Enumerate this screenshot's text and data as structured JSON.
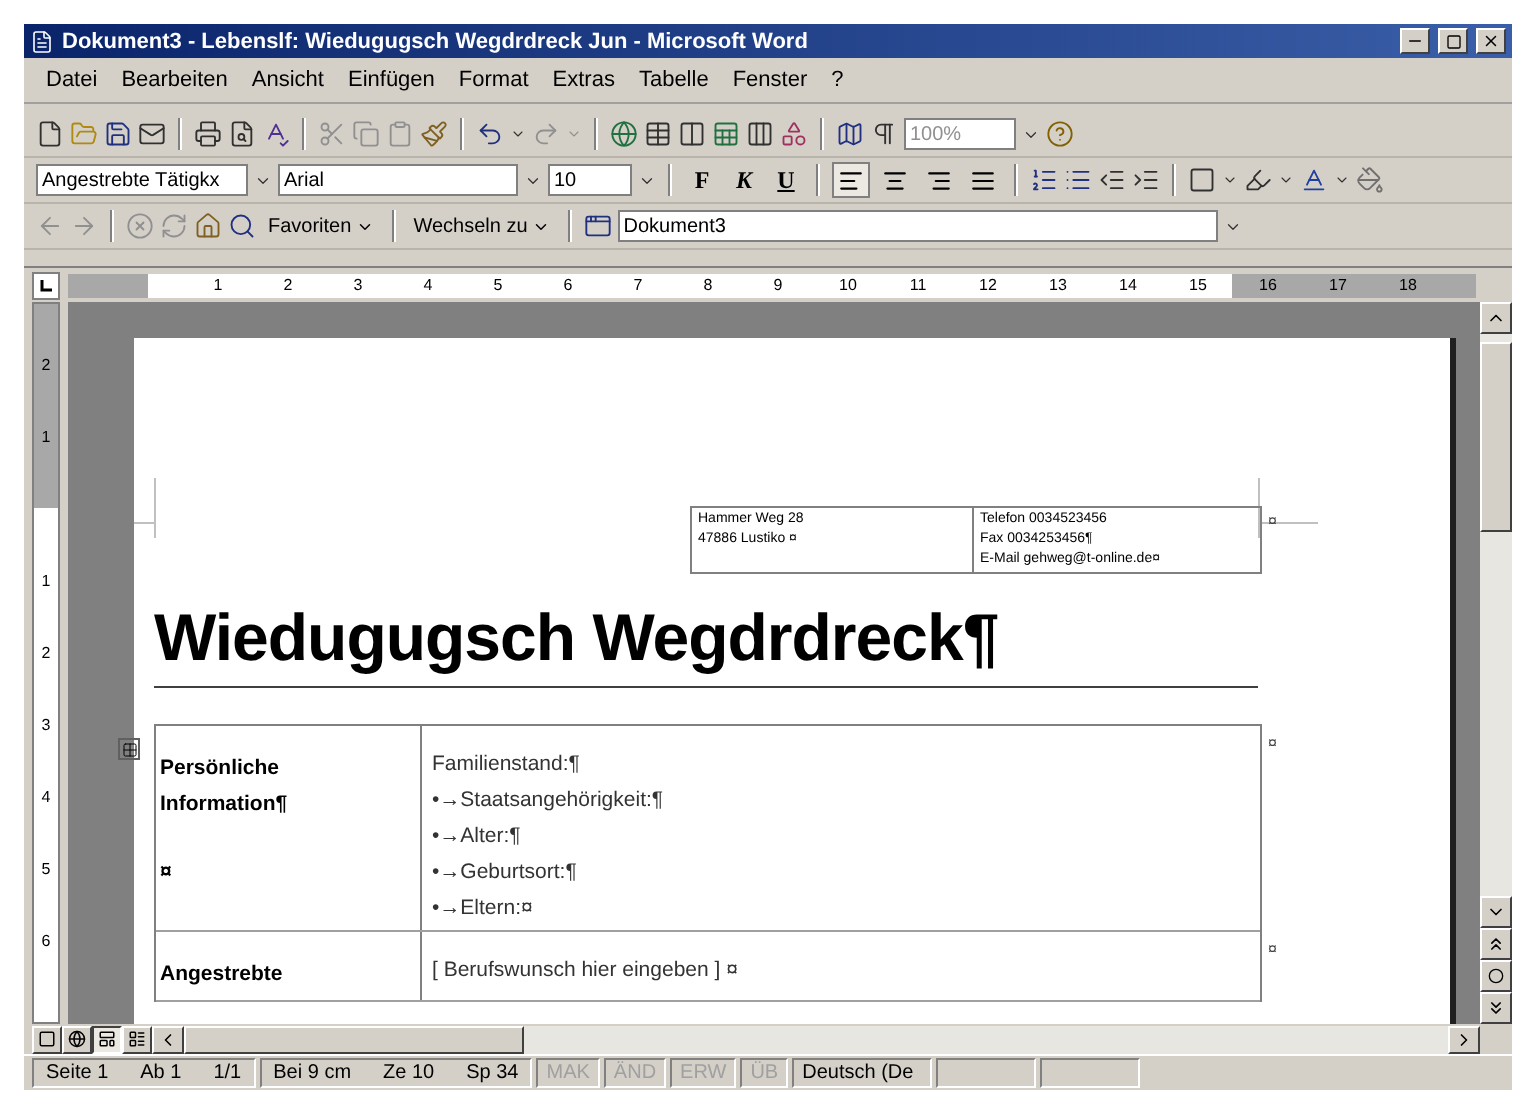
{
  "window": {
    "title": "Dokument3 - Lebenslf: Wiedugugsch Wegdrdreck Jun - Microsoft Word"
  },
  "menu": [
    "Datei",
    "Bearbeiten",
    "Ansicht",
    "Einfügen",
    "Format",
    "Extras",
    "Tabelle",
    "Fenster",
    "?"
  ],
  "standard_toolbar": {
    "zoom": "100%"
  },
  "format_toolbar": {
    "style": "Angestrebte Tätigkx",
    "font": "Arial",
    "size": "10",
    "toggles": [
      {
        "label": "F",
        "selected": false
      },
      {
        "label": "K",
        "selected": false
      },
      {
        "label": "U",
        "selected": false
      }
    ],
    "alignments": [
      {
        "selected": true
      },
      {
        "selected": false
      },
      {
        "selected": false
      },
      {
        "selected": false
      }
    ]
  },
  "web_toolbar": {
    "favorites": "Favoriten",
    "go_to": "Wechseln zu",
    "address": "Dokument3"
  },
  "ruler": {
    "labels": [
      "1",
      "2",
      "3",
      "4",
      "5",
      "6",
      "7",
      "8",
      "9",
      "10",
      "11",
      "12",
      "13",
      "14",
      "15",
      "16",
      "17",
      "18"
    ]
  },
  "vertical_ruler": {
    "top_labels": [
      "2",
      "1"
    ],
    "labels": [
      "1",
      "2",
      "3",
      "4",
      "5",
      "6"
    ]
  },
  "document": {
    "address": {
      "left": [
        "Hammer Weg 28",
        "47886 Lustiko ¤"
      ],
      "right": [
        "Telefon 0034523456",
        "Fax 0034253456¶",
        "E-Mail gehweg@t-online.de¤"
      ],
      "end_mark": "¤"
    },
    "heading": "Wiedugugsch Wegdrdreck¶",
    "sections": [
      {
        "label": "Persönliche Information¶",
        "label_mark": "¤",
        "lines": [
          "Familienstand:¶",
          "•→Staatsangehörigkeit:¶",
          "•→Alter:¶",
          "•→Geburtsort:¶",
          "•→Eltern:¤"
        ],
        "end_mark": "¤"
      },
      {
        "label": "Angestrebte",
        "lines": [
          "[  Berufswunsch hier eingeben  ] ¤"
        ],
        "end_mark": "¤"
      }
    ]
  },
  "views": [
    {
      "selected": false
    },
    {
      "selected": false
    },
    {
      "selected": true
    },
    {
      "selected": false
    }
  ],
  "status_bar": {
    "fields": [
      "Seite 1",
      "Ab 1",
      "1/1",
      "Bei 9 cm",
      "Ze 10",
      "Sp 34"
    ],
    "indicators": [
      {
        "label": "MAK",
        "on": false
      },
      {
        "label": "ÄND",
        "on": false
      },
      {
        "label": "ERW",
        "on": false
      },
      {
        "label": "ÜB",
        "on": false
      }
    ],
    "language": "Deutsch (De"
  }
}
